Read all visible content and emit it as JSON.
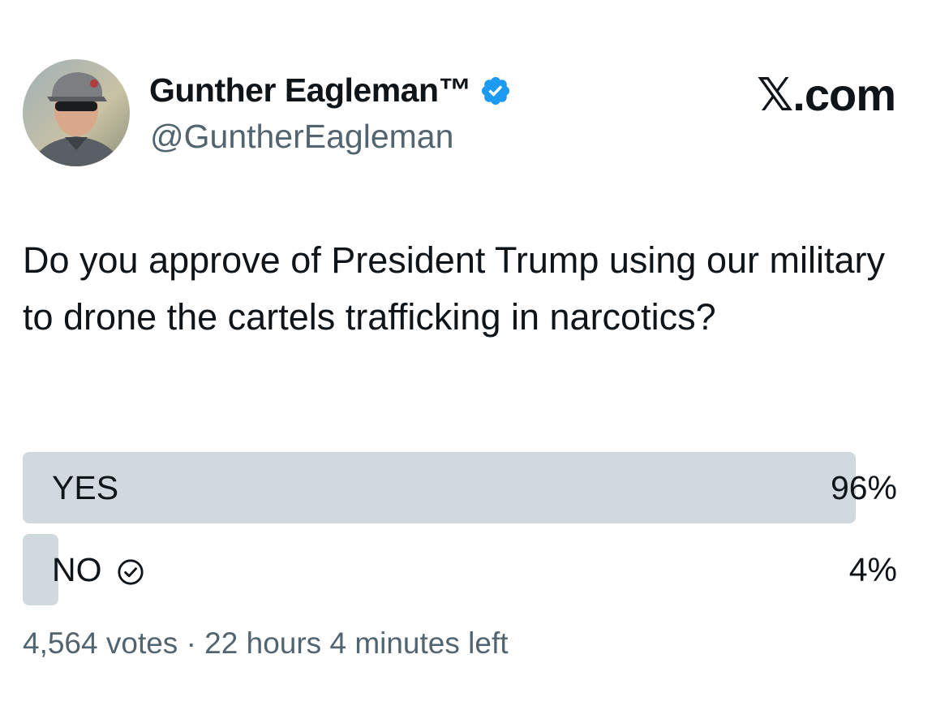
{
  "author": {
    "display_name": "Gunther Eagleman™",
    "handle": "@GuntherEagleman",
    "verified": true,
    "verified_color": "#1d9bf0"
  },
  "brand": "𝕏.com",
  "tweet": {
    "text": "Do you approve of President Trump using our military to drone the cartels trafficking in narcotics?"
  },
  "poll": {
    "options": [
      {
        "label": "YES",
        "percent_label": "96%",
        "share": 0.96,
        "selected": false
      },
      {
        "label": "NO",
        "percent_label": "4%",
        "share": 0.04,
        "selected": true
      }
    ],
    "bar_color": "#cfd9de",
    "meta": "4,564 votes · 22 hours 4 minutes left"
  }
}
